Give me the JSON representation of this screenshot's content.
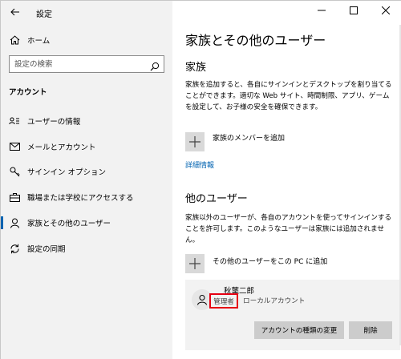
{
  "window": {
    "title": "設定"
  },
  "sidebar": {
    "home_label": "ホーム",
    "search_placeholder": "設定の検索",
    "section_label": "アカウント",
    "items": [
      {
        "label": "ユーザーの情報",
        "icon": "user-info-icon"
      },
      {
        "label": "メールとアカウント",
        "icon": "mail-icon"
      },
      {
        "label": "サインイン オプション",
        "icon": "key-icon"
      },
      {
        "label": "職場または学校にアクセスする",
        "icon": "briefcase-icon"
      },
      {
        "label": "家族とその他のユーザー",
        "icon": "family-icon",
        "selected": true
      },
      {
        "label": "設定の同期",
        "icon": "sync-icon"
      }
    ]
  },
  "main": {
    "page_title": "家族とその他のユーザー",
    "family": {
      "heading": "家族",
      "description": "家族を追加すると、各自にサインインとデスクトップを割り当てることができます。適切な Web サイト、時間制限、アプリ、ゲームを設定して、お子様の安全を確保できます。",
      "add_label": "家族のメンバーを追加",
      "details_link": "詳細情報"
    },
    "others": {
      "heading": "他のユーザー",
      "description": "家族以外のユーザーが、各自のアカウントを使ってサインインすることを許可します。このようなユーザーは家族には追加されません。",
      "add_label": "その他のユーザーをこの PC に追加"
    },
    "user": {
      "name": "秋葉二郎",
      "badge": "管理者",
      "type": "ローカルアカウント",
      "change_button": "アカウントの種類の変更",
      "delete_button": "削除"
    }
  },
  "colors": {
    "accent": "#0063b1",
    "highlight_border": "#e60012",
    "sidebar_bg": "#f2f2f2",
    "button_bg": "#cccccc"
  }
}
